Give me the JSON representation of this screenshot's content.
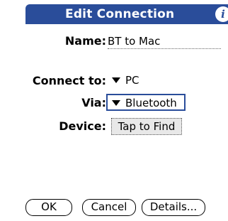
{
  "title": "Edit Connection",
  "info_icon": "info-icon",
  "name": {
    "label": "Name:",
    "value": "BT to Mac"
  },
  "connect_to": {
    "label": "Connect to:",
    "value": "PC"
  },
  "via": {
    "label": "Via:",
    "value": "Bluetooth"
  },
  "device": {
    "label": "Device:",
    "button": "Tap to Find"
  },
  "buttons": {
    "ok": "OK",
    "cancel": "Cancel",
    "details": "Details..."
  },
  "colors": {
    "accent": "#2a4d9a",
    "button_fill": "#e8e8e8"
  }
}
